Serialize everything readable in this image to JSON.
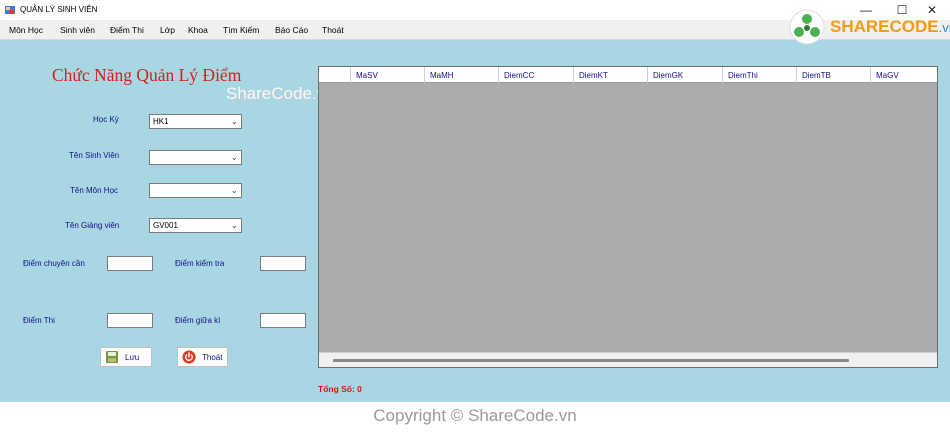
{
  "window": {
    "title": "QUẢN LÝ SINH VIÊN",
    "controls": {
      "minimize": "—",
      "maximize": "☐",
      "close": "✕"
    }
  },
  "menu": [
    "Môn Học",
    "Sinh viên",
    "Điểm Thi",
    "Lớp",
    "Khoa",
    "Tìm Kiếm",
    "Báo Cáo",
    "Thoát"
  ],
  "form": {
    "heading": "Chức Năng Quản Lý Điểm",
    "hoc_ky": {
      "label": "Học Kỳ",
      "value": "HK1"
    },
    "ten_sinh_vien": {
      "label": "Tên Sinh Viên",
      "value": ""
    },
    "ten_mon_hoc": {
      "label": "Tên Môn Học",
      "value": ""
    },
    "ten_giang_vien": {
      "label": "Tên Giảng viên",
      "value": "GV001"
    },
    "diem_chuyen_can": {
      "label": "Điểm chuyên cần",
      "value": ""
    },
    "diem_kiem_tra": {
      "label": "Điểm kiểm tra",
      "value": ""
    },
    "diem_thi": {
      "label": "Điểm Thi",
      "value": ""
    },
    "diem_giua_ki": {
      "label": "Điểm giữa kì",
      "value": ""
    },
    "save_label": "Lưu",
    "exit_label": "Thoát"
  },
  "grid": {
    "columns": [
      "MaSV",
      "MaMH",
      "DiemCC",
      "DiemKT",
      "DiemGK",
      "DiemThi",
      "DiemTB",
      "MaGV"
    ],
    "rows": []
  },
  "total": "Tổng Số: 0",
  "watermark": {
    "overlay": "ShareCode.vn",
    "footer": "Copyright © ShareCode.vn",
    "logo_main": "SHARECODE",
    "logo_suffix": ".vn"
  },
  "colors": {
    "form_background": "#a9d6e3",
    "heading": "#d0211e",
    "label": "#10108a",
    "total": "#e01010",
    "grid_background": "#ababab"
  }
}
